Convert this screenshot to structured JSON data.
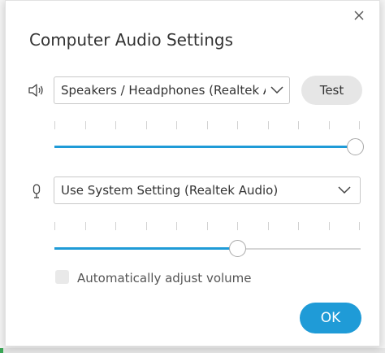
{
  "dialog": {
    "title": "Computer Audio Settings",
    "close_icon": "close-icon"
  },
  "speaker": {
    "icon": "speaker-icon",
    "selected": "Speakers / Headphones (Realtek Audio)",
    "test_label": "Test",
    "volume_level": 1.0
  },
  "microphone": {
    "icon": "microphone-icon",
    "selected": "Use System Setting (Realtek Audio)",
    "volume_level": 0.6
  },
  "auto_adjust": {
    "label": "Automatically adjust volume",
    "checked": false
  },
  "ok_label": "OK",
  "colors": {
    "accent": "#1f9bd7",
    "button_gray": "#e6e6e6",
    "text": "#333333"
  }
}
